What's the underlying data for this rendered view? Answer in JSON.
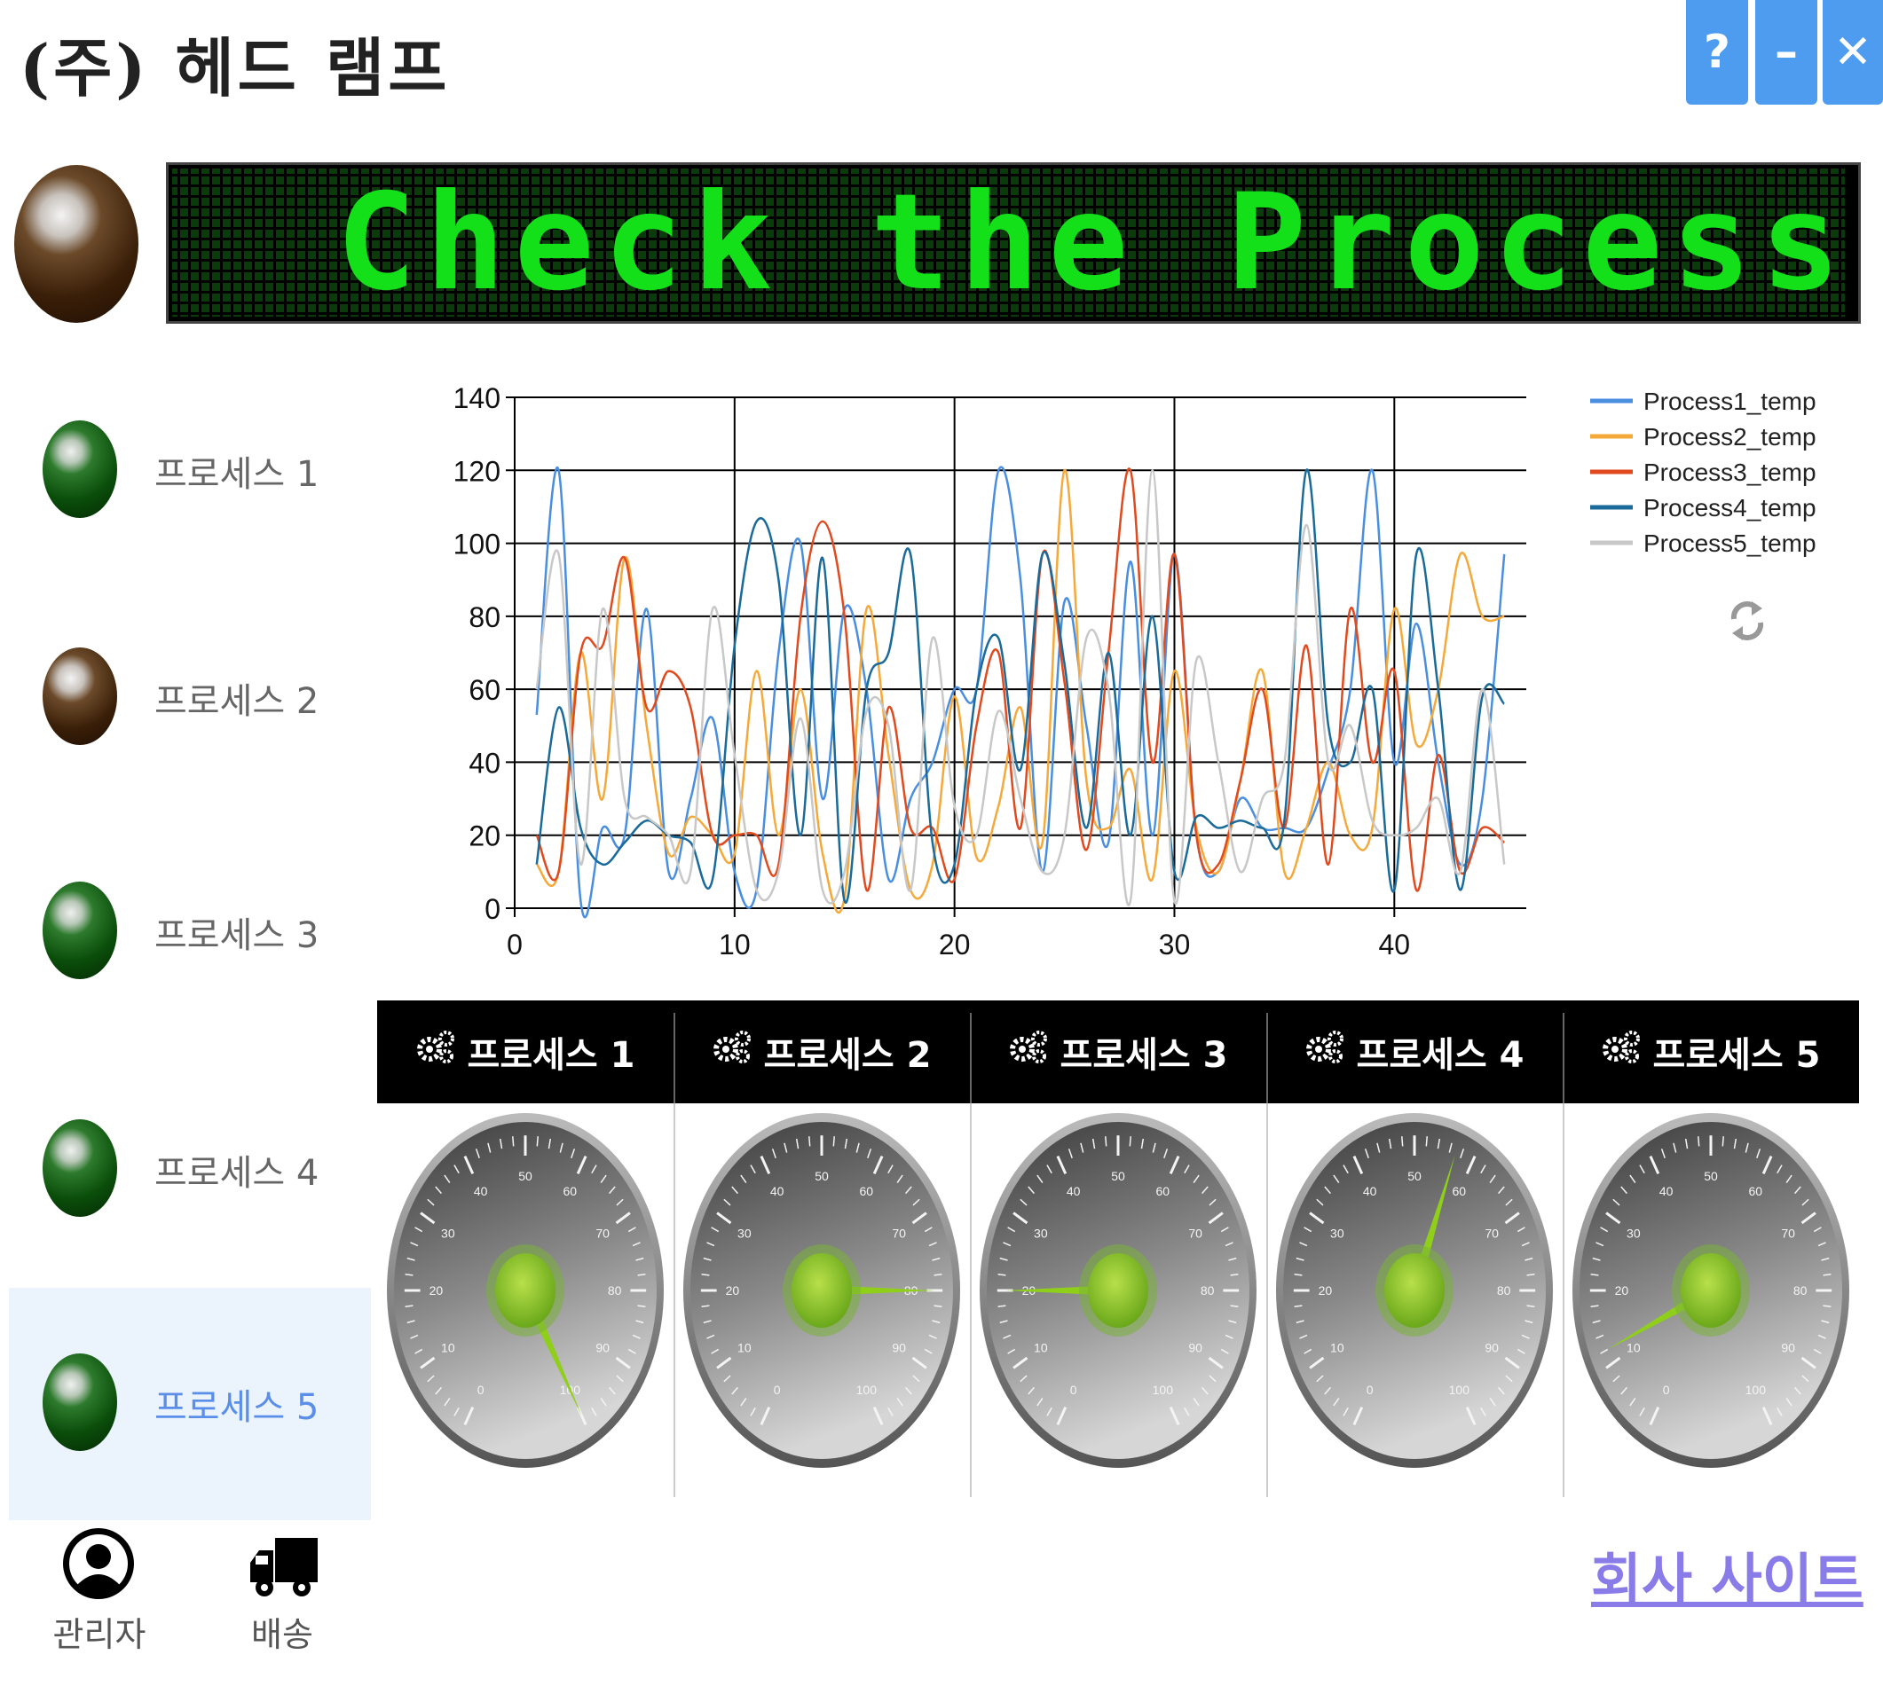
{
  "app": {
    "title": "(주) 헤드 램프"
  },
  "window_buttons": {
    "help": "?",
    "minimize": "–",
    "close": "✕"
  },
  "banner": {
    "text": "Check the Process"
  },
  "sidebar": {
    "items": [
      {
        "label": "프로세스 1",
        "lamp": "green"
      },
      {
        "label": "프로세스 2",
        "lamp": "brown"
      },
      {
        "label": "프로세스 3",
        "lamp": "green"
      },
      {
        "label": "프로세스 4",
        "lamp": "green"
      },
      {
        "label": "프로세스 5",
        "lamp": "green",
        "selected": true
      }
    ]
  },
  "chart_data": {
    "type": "line",
    "xlim": [
      0,
      46
    ],
    "ylim": [
      0,
      140
    ],
    "x_ticks": [
      0,
      10,
      20,
      30,
      40
    ],
    "y_ticks": [
      0,
      20,
      40,
      60,
      80,
      100,
      120,
      140
    ],
    "grid": true,
    "legend_position": "top-right",
    "x": [
      1,
      2,
      3,
      4,
      5,
      6,
      7,
      8,
      9,
      10,
      11,
      12,
      13,
      14,
      15,
      16,
      17,
      18,
      19,
      20,
      21,
      22,
      23,
      24,
      25,
      26,
      27,
      28,
      29,
      30,
      31,
      32,
      33,
      34,
      35,
      36,
      37,
      38,
      39,
      40,
      41,
      42,
      43,
      44,
      45
    ],
    "series": [
      {
        "name": "Process1_temp",
        "color": "#4a8ee0",
        "values": [
          53,
          120,
          2,
          22,
          20,
          82,
          10,
          30,
          52,
          10,
          5,
          70,
          100,
          30,
          82,
          60,
          8,
          30,
          40,
          60,
          60,
          120,
          90,
          10,
          84,
          50,
          18,
          95,
          20,
          97,
          20,
          10,
          30,
          22,
          22,
          22,
          38,
          60,
          120,
          40,
          78,
          40,
          12,
          30,
          97
        ]
      },
      {
        "name": "Process2_temp",
        "color": "#f5a93a",
        "values": [
          12,
          10,
          70,
          30,
          96,
          50,
          15,
          25,
          20,
          15,
          65,
          20,
          60,
          15,
          3,
          82,
          42,
          5,
          12,
          58,
          14,
          28,
          55,
          18,
          120,
          35,
          22,
          38,
          8,
          65,
          22,
          10,
          35,
          65,
          10,
          22,
          40,
          20,
          22,
          82,
          45,
          60,
          97,
          80,
          80
        ]
      },
      {
        "name": "Process3_temp",
        "color": "#e04a1e",
        "values": [
          20,
          10,
          70,
          72,
          96,
          55,
          65,
          55,
          20,
          20,
          20,
          12,
          80,
          106,
          80,
          5,
          55,
          22,
          22,
          8,
          50,
          70,
          22,
          97,
          62,
          16,
          70,
          120,
          40,
          97,
          20,
          12,
          35,
          60,
          22,
          72,
          12,
          82,
          40,
          65,
          5,
          42,
          10,
          22,
          18
        ]
      },
      {
        "name": "Process4_temp",
        "color": "#1a6a9a",
        "values": [
          12,
          55,
          22,
          12,
          18,
          24,
          20,
          18,
          8,
          72,
          106,
          90,
          20,
          96,
          2,
          60,
          70,
          97,
          18,
          12,
          60,
          74,
          38,
          97,
          67,
          22,
          70,
          20,
          80,
          10,
          25,
          22,
          24,
          22,
          24,
          120,
          50,
          40,
          60,
          5,
          97,
          60,
          5,
          58,
          56
        ]
      },
      {
        "name": "Process5_temp",
        "color": "#c8c8c8",
        "values": [
          60,
          97,
          12,
          82,
          30,
          25,
          20,
          10,
          82,
          42,
          5,
          10,
          52,
          5,
          10,
          54,
          50,
          5,
          74,
          28,
          20,
          54,
          30,
          10,
          20,
          74,
          60,
          2,
          120,
          2,
          68,
          40,
          10,
          30,
          40,
          105,
          40,
          50,
          24,
          20,
          22,
          30,
          10,
          60,
          12
        ]
      }
    ]
  },
  "gauges": [
    {
      "label": "프로세스 1",
      "value": 100
    },
    {
      "label": "프로세스 2",
      "value": 80
    },
    {
      "label": "프로세스 3",
      "value": 20
    },
    {
      "label": "프로세스 4",
      "value": 57
    },
    {
      "label": "프로세스 5",
      "value": 12
    }
  ],
  "gauge_scale": {
    "min": 0,
    "max": 100,
    "labels": [
      "0",
      "10",
      "20",
      "30",
      "40",
      "50",
      "60",
      "70",
      "80",
      "90",
      "100"
    ]
  },
  "bottom": {
    "admin_label": "관리자",
    "delivery_label": "배송",
    "company_link": "회사 사이트"
  }
}
